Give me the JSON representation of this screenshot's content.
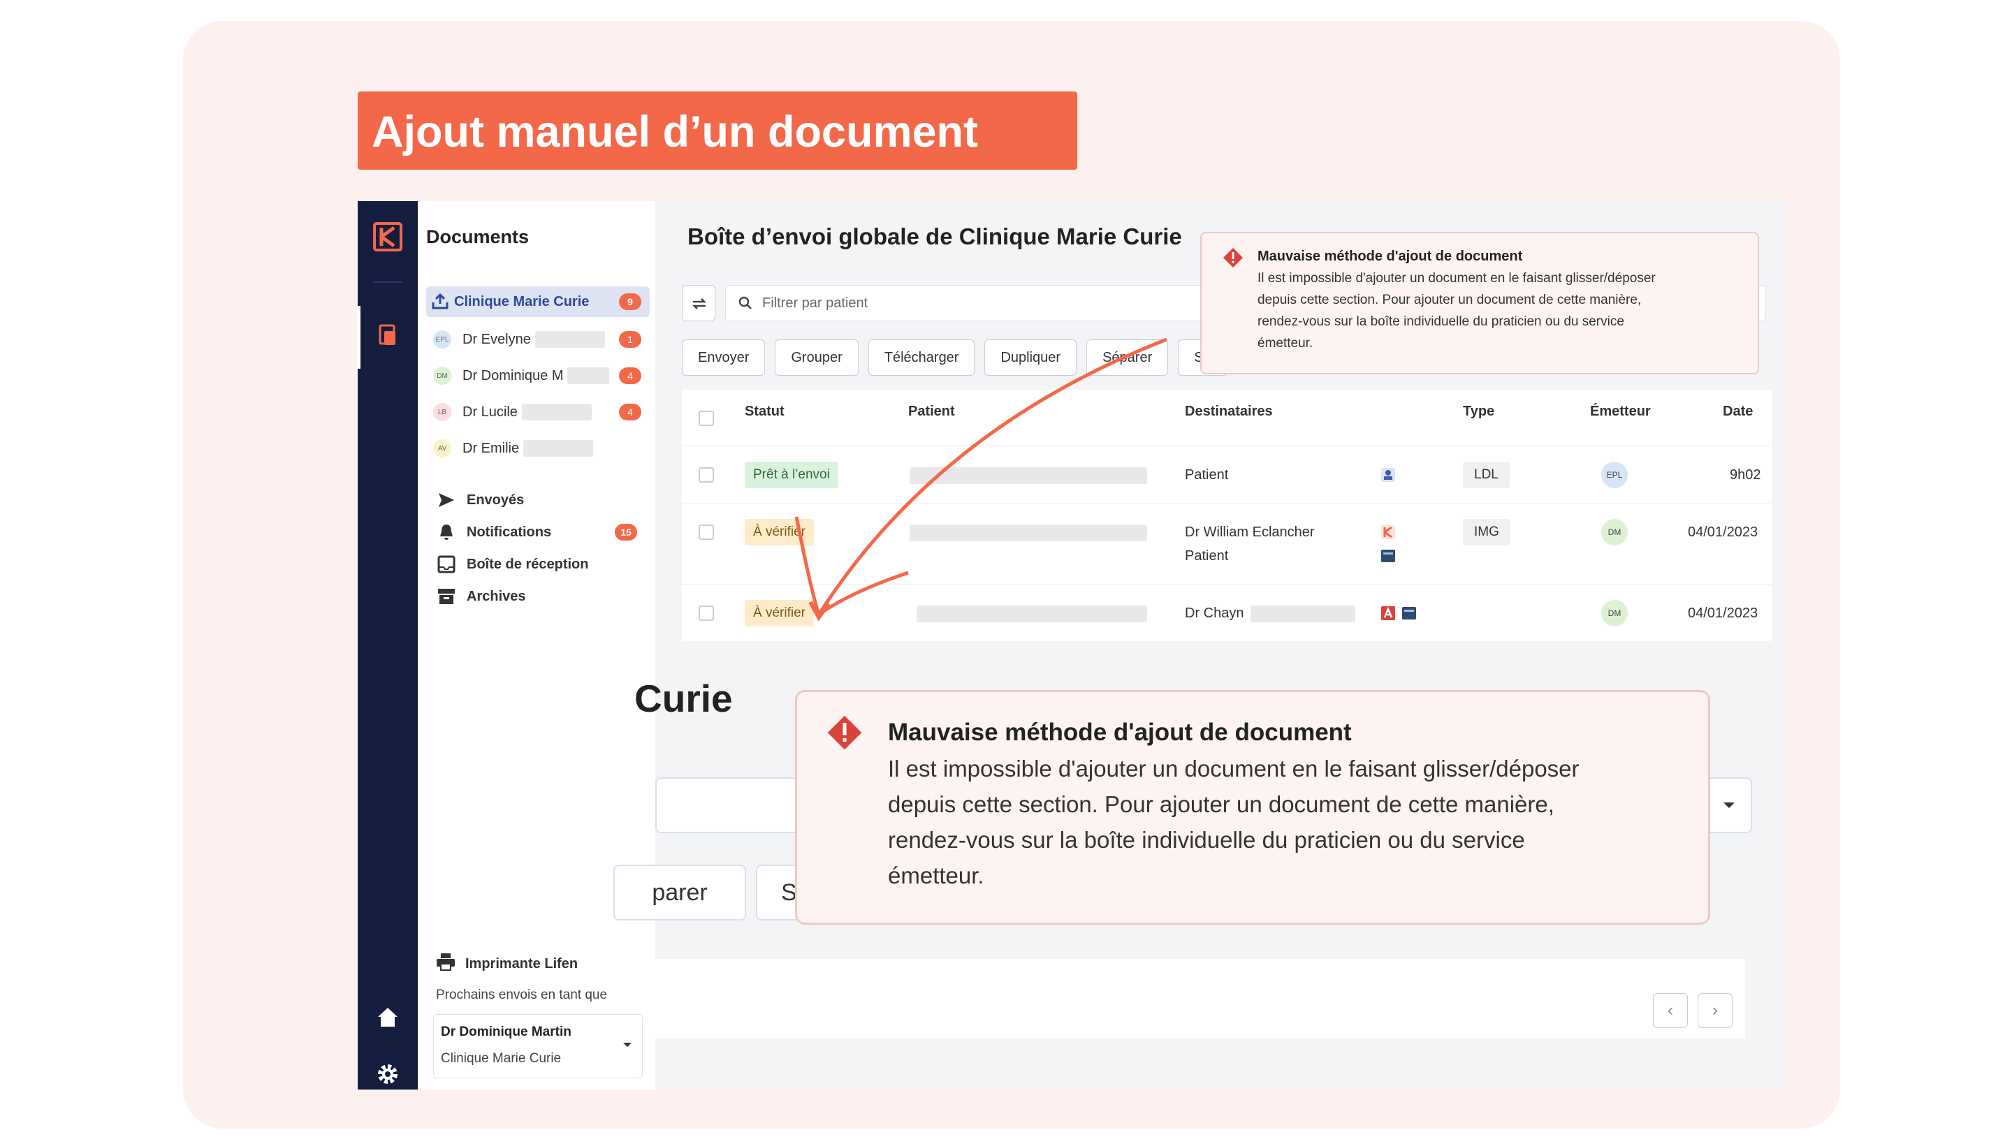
{
  "banner": {
    "title": "Ajout manuel d’un document"
  },
  "colors": {
    "accent": "#f4684a",
    "rail": "#151d3e",
    "active_blue": "#2c4a9a"
  },
  "sidebar": {
    "title": "Documents",
    "active_inbox": {
      "label": "Clinique Marie Curie",
      "count": "9"
    },
    "practitioners": [
      {
        "initials": "EPL",
        "label": "Dr Evelyne",
        "count": "1"
      },
      {
        "initials": "DM",
        "label": "Dr Dominique M",
        "count": "4"
      },
      {
        "initials": "LB",
        "label": "Dr Lucile",
        "count": "4"
      },
      {
        "initials": "AV",
        "label": "Dr Emilie",
        "count": ""
      }
    ],
    "links": [
      {
        "icon": "send-icon",
        "label": "Envoyés",
        "count": ""
      },
      {
        "icon": "bell-icon",
        "label": "Notifications",
        "count": "15"
      },
      {
        "icon": "inbox-icon",
        "label": "Boîte de réception",
        "count": ""
      },
      {
        "icon": "archive-icon",
        "label": "Archives",
        "count": ""
      }
    ],
    "printer": {
      "label": "Imprimante Lifen",
      "subtitle": "Prochains envois en tant que"
    },
    "sender": {
      "name": "Dr Dominique Martin",
      "org": "Clinique Marie Curie"
    }
  },
  "main": {
    "title": "Boîte d’envoi globale de Clinique Marie Curie",
    "filter_placeholder": "Filtrer par patient",
    "toolbar": [
      "Envoyer",
      "Grouper",
      "Télécharger",
      "Dupliquer",
      "Séparer",
      "Su"
    ],
    "columns": {
      "status": "Statut",
      "patient": "Patient",
      "recipients": "Destinataires",
      "type": "Type",
      "emitter": "Émetteur",
      "date": "Date"
    },
    "rows": [
      {
        "status": "Prêt à l’envoi",
        "recipient1": "Patient",
        "recipient2": "",
        "type": "LDL",
        "emitter": "EPL",
        "date": "9h02"
      },
      {
        "status": "À vérifier",
        "recipient1": "Dr William Eclancher",
        "recipient2": "Patient",
        "type": "IMG",
        "emitter": "DM",
        "date": "04/01/2023"
      },
      {
        "status": "À vérifier",
        "recipient1": "Dr Chayn",
        "recipient2": "",
        "type": "",
        "emitter": "DM",
        "date": "04/01/2023"
      }
    ]
  },
  "zoom": {
    "title": "Curie",
    "btn1": "parer",
    "btn2": "Su"
  },
  "alert": {
    "title": "Mauvaise méthode d'ajout de document",
    "line1": "Il est impossible d'ajouter un document en le faisant glisser/déposer",
    "line2": "depuis cette section. Pour ajouter un document de cette manière,",
    "line3": "rendez-vous sur la boîte individuelle du praticien ou du service",
    "line4": "émetteur."
  }
}
